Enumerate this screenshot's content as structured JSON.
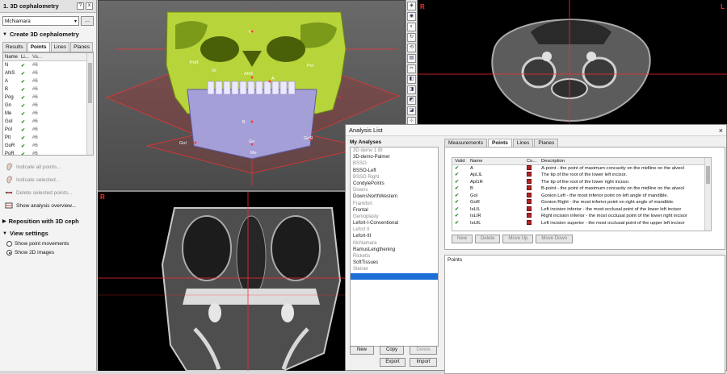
{
  "left_panel": {
    "title": "1. 3D cephalometry",
    "header_buttons": [
      "?",
      "x"
    ],
    "analysis_select": "McNamara",
    "browse_button": "...",
    "create_section": "Create 3D cephalometry",
    "tabs": [
      "Results",
      "Points",
      "Lines",
      "Planes"
    ],
    "active_tab": "Points",
    "table_headers": [
      "Name",
      "Li...",
      "Va..."
    ],
    "points": [
      {
        "name": "N",
        "value": "#6"
      },
      {
        "name": "ANS",
        "value": "#6"
      },
      {
        "name": "A",
        "value": "#6"
      },
      {
        "name": "B",
        "value": "#6"
      },
      {
        "name": "Pog",
        "value": "#6"
      },
      {
        "name": "Gn",
        "value": "#6"
      },
      {
        "name": "Me",
        "value": "#6"
      },
      {
        "name": "GoI",
        "value": "#6"
      },
      {
        "name": "PoI",
        "value": "#6"
      },
      {
        "name": "PtI",
        "value": "#6"
      },
      {
        "name": "GoR",
        "value": "#6"
      },
      {
        "name": "PoR",
        "value": "#6"
      }
    ],
    "actions": [
      {
        "label": "Indicate all points...",
        "dim": true,
        "icon": "ear-icon"
      },
      {
        "label": "Indicate selected...",
        "dim": true,
        "icon": "ear-icon"
      },
      {
        "label": "Delete selected points...",
        "dim": true,
        "icon": "delete-points-icon"
      },
      {
        "label": "Show analysis overview...",
        "dim": false,
        "icon": "overview-icon"
      }
    ],
    "reposition_section": "Reposition with 3D ceph",
    "view_section": "View settings",
    "view_options": [
      {
        "label": "Show point movements",
        "selected": false
      },
      {
        "label": "Show 2D images",
        "selected": true
      }
    ]
  },
  "viewports": {
    "axial_marker_left": "R",
    "axial_marker_right": "L",
    "coronal_marker": "R",
    "landmark_labels": [
      "PoR",
      "Or",
      "PoI",
      "N",
      "ANS",
      "A",
      "B",
      "Gn",
      "Me",
      "GoI",
      "GoR"
    ],
    "crosshair_color": "#ff2b2b"
  },
  "toolbar": {
    "buttons": [
      "view-3d-icon",
      "palette-icon",
      "hide-icon",
      "rotate-icon",
      "reset-icon",
      "layer-icon",
      "clip-icon",
      "cube-icon",
      "cube-side-icon",
      "cube-front-icon",
      "cube-top-icon",
      "measure-icon",
      "zoom-icon"
    ]
  },
  "dialog": {
    "title": "Analysis List",
    "close": "×",
    "my_analyses_label": "My Analyses",
    "analyses": [
      {
        "label": "3D demo 1 BI",
        "dim": true
      },
      {
        "label": "3D-demo-Palmer",
        "dim": false
      },
      {
        "label": "BSSO",
        "dim": true
      },
      {
        "label": "BSSO-Left",
        "dim": false
      },
      {
        "label": "BSSO Right",
        "dim": true
      },
      {
        "label": "CondylePoints",
        "dim": false
      },
      {
        "label": "Downs",
        "dim": true
      },
      {
        "label": "DownsNorthWestern",
        "dim": false
      },
      {
        "label": "Frankfort",
        "dim": true
      },
      {
        "label": "Frontal",
        "dim": false
      },
      {
        "label": "Genioplasty",
        "dim": true
      },
      {
        "label": "Lefort-I-Conventional",
        "dim": false
      },
      {
        "label": "Lefort II",
        "dim": true
      },
      {
        "label": "Lefort-III",
        "dim": false
      },
      {
        "label": "McNamara",
        "dim": true
      },
      {
        "label": "RamusLengthening",
        "dim": false
      },
      {
        "label": "Ricketts",
        "dim": true
      },
      {
        "label": "SoftTissues",
        "dim": false
      },
      {
        "label": "Steiner",
        "dim": true
      },
      {
        "label": "USSD",
        "dim": false,
        "selected": true
      }
    ],
    "left_buttons": {
      "new": "New",
      "copy": "Copy",
      "delete": "Delete",
      "export": "Export",
      "import": "Import"
    },
    "tabs": [
      "Measurements",
      "Points",
      "Lines",
      "Planes"
    ],
    "active_tab": "Points",
    "table_headers": [
      "Valid",
      "Name",
      "Co...",
      "Description"
    ],
    "point_rows": [
      {
        "valid": "✔",
        "name": "A",
        "desc": "A-point - the point of maximum concavity on the midline on the alveol"
      },
      {
        "valid": "✔",
        "name": "ApLIL",
        "desc": "The tip of the root of the lower left incisor."
      },
      {
        "valid": "✔",
        "name": "Apl1R",
        "desc": "The tip of the root of the lower right incisor."
      },
      {
        "valid": "✔",
        "name": "B",
        "desc": "B-point - the point of maximum concavity on the midline on the alveol"
      },
      {
        "valid": "✔",
        "name": "GoI",
        "desc": "Gonion Left - the most inferior point on left angle of mandible."
      },
      {
        "valid": "✔",
        "name": "GoR",
        "desc": "Gonion Right - the most inferior point on right angle of mandible."
      },
      {
        "valid": "✔",
        "name": "IsLIL",
        "desc": "Left incision inferior - the most occlusal point of the lower left incisor"
      },
      {
        "valid": "✔",
        "name": "IsLIR",
        "desc": "Right incision inferior - the most occlusal point of the lower right incisor"
      },
      {
        "valid": "✔",
        "name": "IsUIL",
        "desc": "Left incision superior - the most occlusal point of the upper left incisor"
      }
    ],
    "action_buttons": [
      "New",
      "Delete",
      "Move Up",
      "Move Down"
    ],
    "points_area_label": "Points"
  }
}
